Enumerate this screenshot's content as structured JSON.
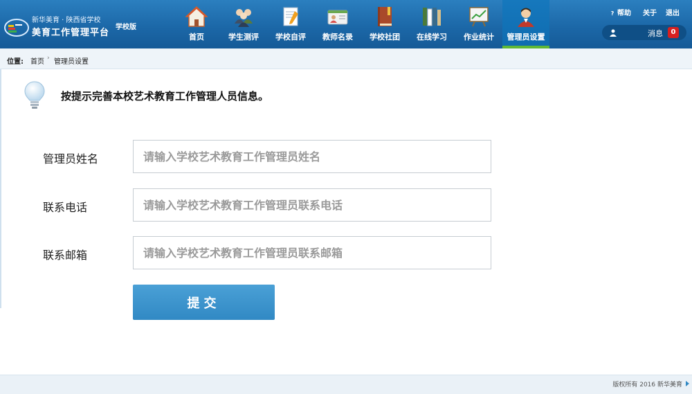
{
  "header": {
    "logo_line1": "新华美育 · 陕西省学校",
    "logo_line2": "美育工作管理平台",
    "edition": "学校版",
    "nav": [
      {
        "label": "首页",
        "icon": "home-icon"
      },
      {
        "label": "学生测评",
        "icon": "students-icon"
      },
      {
        "label": "学校自评",
        "icon": "self-evaluation-icon"
      },
      {
        "label": "教师名录",
        "icon": "teacher-card-icon"
      },
      {
        "label": "学校社团",
        "icon": "club-book-icon"
      },
      {
        "label": "在线学习",
        "icon": "books-icon"
      },
      {
        "label": "作业统计",
        "icon": "chart-board-icon"
      },
      {
        "label": "管理员设置",
        "icon": "admin-avatar-icon",
        "active": true
      }
    ],
    "help_label": "帮助",
    "about_label": "关于",
    "logout_label": "退出",
    "messages_label": "消息",
    "messages_count": "0"
  },
  "breadcrumb": {
    "prefix": "位置:",
    "home": "首页",
    "current": "管理员设置"
  },
  "main": {
    "hint": "按提示完善本校艺术教育工作管理人员信息。",
    "fields": [
      {
        "label": "管理员姓名",
        "placeholder": "请输入学校艺术教育工作管理员姓名",
        "value": ""
      },
      {
        "label": "联系电话",
        "placeholder": "请输入学校艺术教育工作管理员联系电话",
        "value": ""
      },
      {
        "label": "联系邮箱",
        "placeholder": "请输入学校艺术教育工作管理员联系邮箱",
        "value": ""
      }
    ],
    "submit_label": "提交"
  },
  "footer": {
    "copyright": "版权所有 2016 新华美育"
  },
  "colors": {
    "header_blue": "#1c68a8",
    "active_underline": "#5fb836",
    "button_blue": "#3189c4",
    "badge_red": "#d82020"
  }
}
